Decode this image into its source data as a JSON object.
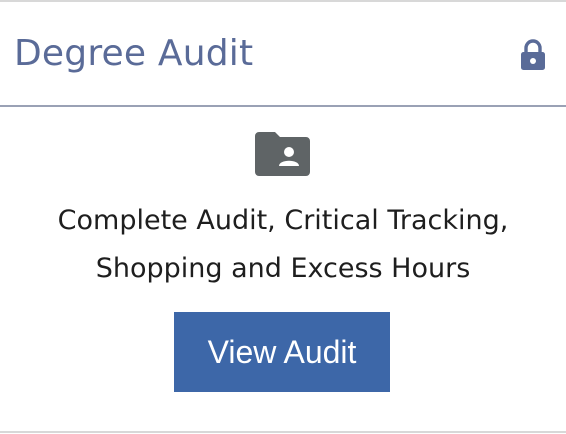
{
  "card": {
    "title": "Degree Audit",
    "lock_icon": "lock-icon",
    "folder_icon": "folder-user-icon",
    "description_line1": "Complete Audit, Critical Tracking,",
    "description_line2": "Shopping and Excess Hours",
    "button_label": "View Audit"
  },
  "colors": {
    "title": "#5a6b98",
    "icon": "#5a6b98",
    "folder_icon": "#5f6466",
    "button_bg": "#3d67a8",
    "button_text": "#ffffff",
    "body_text": "#1e1e1e"
  }
}
